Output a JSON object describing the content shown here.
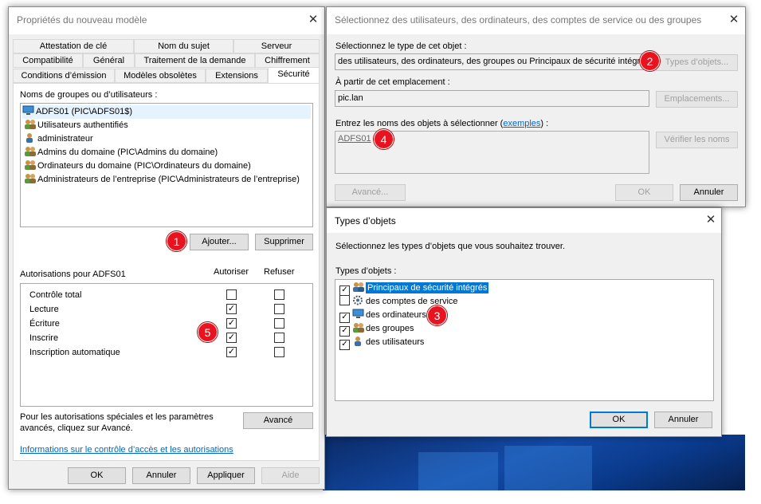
{
  "dialog_props": {
    "title": "Propriétés du nouveau modèle",
    "tabs": {
      "row1": [
        "Attestation de clé",
        "Nom du sujet",
        "Serveur"
      ],
      "row2": [
        "Compatibilité",
        "Général",
        "Traitement de la demande",
        "Chiffrement"
      ],
      "row3": [
        "Conditions d’émission",
        "Modèles obsolètes",
        "Extensions",
        "Sécurité"
      ]
    },
    "groups_label": "Noms de groupes ou d’utilisateurs :",
    "groups": [
      "ADFS01 (PIC\\ADFS01$)",
      "Utilisateurs authentifiés",
      "administrateur",
      "Admins du domaine (PIC\\Admins du domaine)",
      "Ordinateurs du domaine (PIC\\Ordinateurs du domaine)",
      "Administrateurs de l’entreprise (PIC\\Administrateurs de l’entreprise)"
    ],
    "add_button": "Ajouter...",
    "remove_button": "Supprimer",
    "permissions_label": "Autorisations pour ADFS01",
    "allow_header": "Autoriser",
    "deny_header": "Refuser",
    "permissions": [
      {
        "name": "Contrôle total",
        "allow": false,
        "deny": false
      },
      {
        "name": "Lecture",
        "allow": true,
        "deny": false
      },
      {
        "name": "Écriture",
        "allow": true,
        "deny": false
      },
      {
        "name": "Inscrire",
        "allow": true,
        "deny": false
      },
      {
        "name": "Inscription automatique",
        "allow": true,
        "deny": false
      }
    ],
    "special_text_1": "Pour les autorisations spéciales et les paramètres",
    "special_text_2": "avancés, cliquez sur Avancé.",
    "advanced_button": "Avancé",
    "info_link": "Informations sur le contrôle d’accès et les autorisations",
    "ok": "OK",
    "cancel": "Annuler",
    "apply": "Appliquer",
    "help": "Aide"
  },
  "dialog_select": {
    "title": "Sélectionnez des utilisateurs, des ordinateurs, des comptes de service ou des groupes",
    "type_label": "Sélectionnez le type de cet objet :",
    "type_value": "des utilisateurs, des ordinateurs, des groupes ou Principaux de sécurité intégrés",
    "types_button": "Types d’objets...",
    "location_label": "À partir de cet emplacement :",
    "location_value": "pic.lan",
    "locations_button": "Emplacements...",
    "names_label_pre": "Entrez les noms des objets à sélectionner (",
    "names_link": "exemples",
    "names_label_post": ") :",
    "names_value": "ADFS01",
    "check_names_button": "Vérifier les noms",
    "advanced_button": "Avancé...",
    "ok": "OK",
    "cancel": "Annuler"
  },
  "dialog_types": {
    "title": "Types d’objets",
    "description": "Sélectionnez les types d’objets que vous souhaitez trouver.",
    "list_label": "Types d’objets :",
    "items": [
      {
        "label": "Principaux de sécurité intégrés",
        "checked": true
      },
      {
        "label": "des comptes de service",
        "checked": false
      },
      {
        "label": "des ordinateurs",
        "checked": true
      },
      {
        "label": "des groupes",
        "checked": true
      },
      {
        "label": "des utilisateurs",
        "checked": true
      }
    ],
    "ok": "OK",
    "cancel": "Annuler"
  },
  "badges": [
    "1",
    "2",
    "3",
    "4",
    "5"
  ],
  "colors": {
    "badge": "#e8131e",
    "selection": "#0078d7",
    "link": "#0066cc"
  }
}
